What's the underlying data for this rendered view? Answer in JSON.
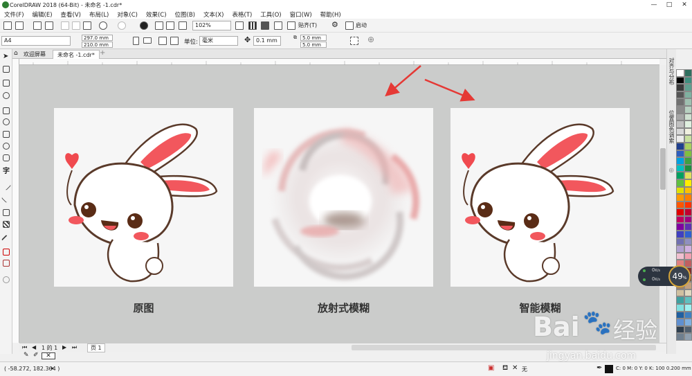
{
  "window": {
    "title": "CorelDRAW 2018 (64-Bit) - 未命名 -1.cdr*"
  },
  "menu": [
    "文件(F)",
    "编辑(E)",
    "查看(V)",
    "布局(L)",
    "对象(C)",
    "效果(C)",
    "位图(B)",
    "文本(X)",
    "表格(T)",
    "工具(O)",
    "窗口(W)",
    "帮助(H)"
  ],
  "toolbar": {
    "zoom": "102%",
    "snap_label": "贴齐(T)",
    "launch_label": "启动"
  },
  "propbar": {
    "page_size": "A4",
    "width": "297.0 mm",
    "height": "210.0 mm",
    "units_label": "单位:",
    "units_value": "毫米",
    "nudge": "0.1 mm",
    "dup_x": "5.0 mm",
    "dup_y": "5.0 mm"
  },
  "tabs": {
    "welcome": "欢迎屏幕",
    "doc": "未命名 -1.cdr*"
  },
  "captions": {
    "original": "原图",
    "radial": "放射式模糊",
    "smart": "智能模糊"
  },
  "docker": {
    "align": "对齐与分布",
    "pos": "位置图色调索"
  },
  "pagebar": {
    "page_of": "1 的 1",
    "page_label": "页 1"
  },
  "status": {
    "coords": "( -58.272, 182.364 )",
    "fill": "无",
    "color_info": "C: 0 M: 0 Y: 0 K: 100  0.200 mm"
  },
  "perf": {
    "cpu": "49",
    "cpu_unit": "%",
    "up": "0",
    "down": "0",
    "rate_unit": "K/s"
  },
  "watermark": {
    "brand": "Bai",
    "brand2": "经验",
    "url": "jingyan.baidu.com"
  },
  "colors": {
    "accent_red": "#e53935",
    "rabbit_pink": "#f2575d",
    "outline": "#5a3a2a"
  }
}
